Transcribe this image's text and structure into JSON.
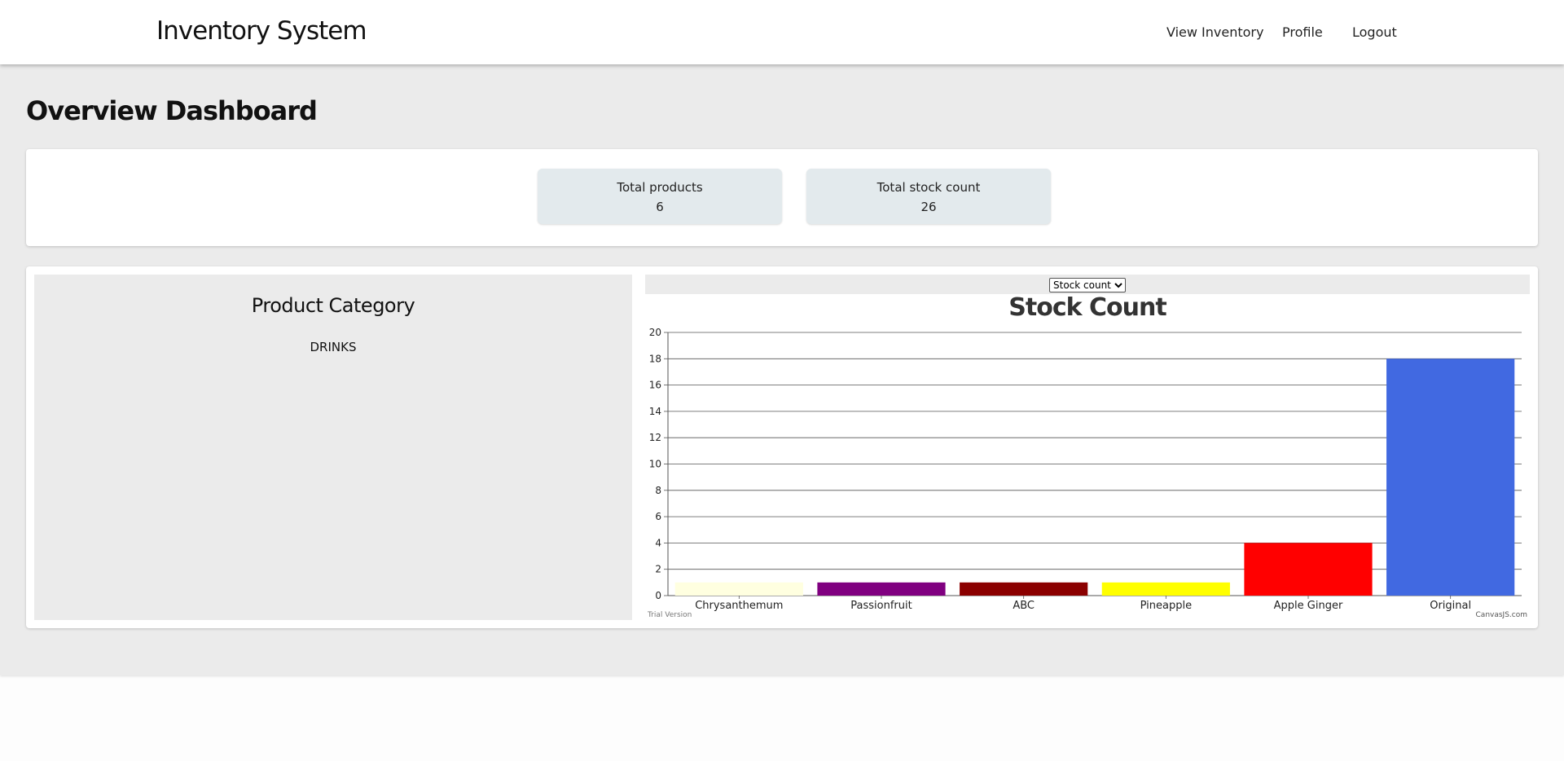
{
  "navbar": {
    "brand": "Inventory System",
    "links": [
      "View Inventory",
      "Profile",
      "Logout"
    ]
  },
  "page": {
    "title": "Overview Dashboard"
  },
  "stats": [
    {
      "label": "Total products",
      "value": "6"
    },
    {
      "label": "Total stock count",
      "value": "26"
    }
  ],
  "category": {
    "title": "Product Category",
    "items": [
      "DRINKS"
    ]
  },
  "chart_select": {
    "selected": "Stock count",
    "options": [
      "Stock count"
    ]
  },
  "chart_data": {
    "type": "bar",
    "title": "Stock Count",
    "categories": [
      "Chrysanthemum",
      "Passionfruit",
      "ABC",
      "Pineapple",
      "Apple Ginger",
      "Original"
    ],
    "values": [
      1,
      1,
      1,
      1,
      4,
      18
    ],
    "colors": [
      "#ffffe0",
      "#800080",
      "#8b0000",
      "#ffff00",
      "#ff0000",
      "#4169e1"
    ],
    "ylim": [
      0,
      20
    ],
    "yticks": [
      0,
      2,
      4,
      6,
      8,
      10,
      12,
      14,
      16,
      18,
      20
    ],
    "grid": true,
    "footer_left": "Trial Version",
    "footer_right": "CanvasJS.com"
  }
}
